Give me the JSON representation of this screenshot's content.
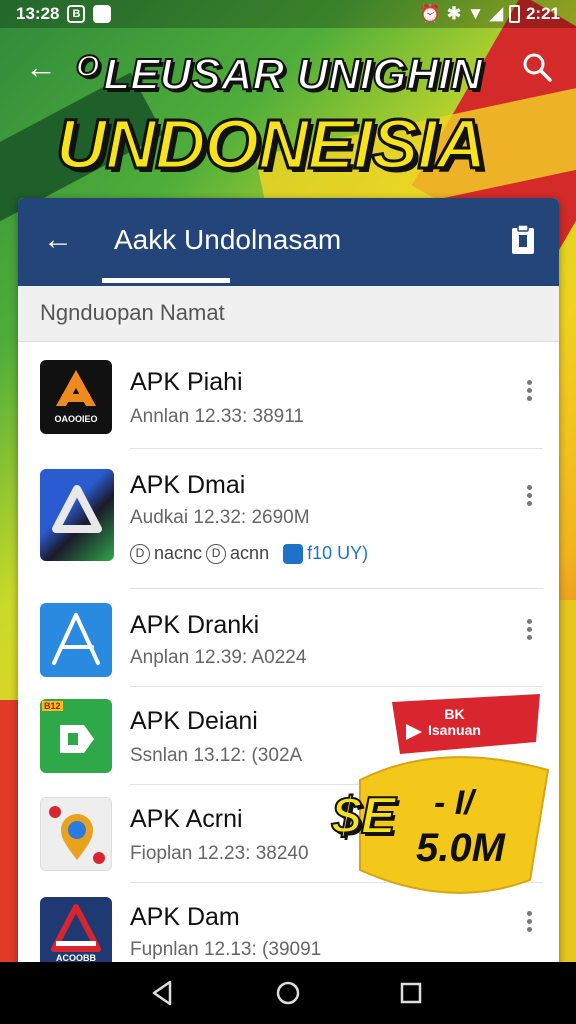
{
  "status_bar": {
    "time_left": "13:28",
    "badge1": "B",
    "time_right": "2:21"
  },
  "hero": {
    "title_line1": "LEUSAR UNIGHIN",
    "title_line2": "UNDONEISIA",
    "prefix_glyph": "O"
  },
  "app_bar": {
    "title": "Aakk Undolnasam"
  },
  "section": {
    "label": "Ngnduopan Namat"
  },
  "apps": [
    {
      "name": "APK Piahi",
      "meta": "Annlan 12.33: 38911",
      "icon_label": "OAOOIEO"
    },
    {
      "name": "APK Dmai",
      "meta": "Audkai 12.32: 2690M",
      "tags_text": "nacnc",
      "tags_text2": "acnn",
      "tags_blue": "f10 UY)"
    },
    {
      "name": "APK Dranki",
      "meta": "Anplan 12.39: A0224"
    },
    {
      "name": "APK Deiani",
      "meta": "Ssnlan 13.12: (302A",
      "icon_badge": "B12"
    },
    {
      "name": "APK Acrni",
      "meta": "Fioplan 12.23: 38240"
    },
    {
      "name": "APK Dam",
      "meta": "Fupnlan 12.13: (39091",
      "icon_label": "ACOOBB"
    }
  ],
  "promo": {
    "badge_line1": "BK",
    "badge_line2": "Isanuan",
    "price_left": "$E",
    "price_right_top": "- I/",
    "price_right_bottom": "5.0M"
  },
  "colors": {
    "app_bar": "#24457a",
    "accent_yellow": "#f7e21e",
    "promo_red": "#d9262e",
    "promo_yellow": "#f4c81a"
  },
  "icons": [
    "back-arrow-icon",
    "search-icon",
    "clipboard-icon",
    "more-vert-icon",
    "nav-back-icon",
    "nav-home-icon",
    "nav-recents-icon"
  ]
}
